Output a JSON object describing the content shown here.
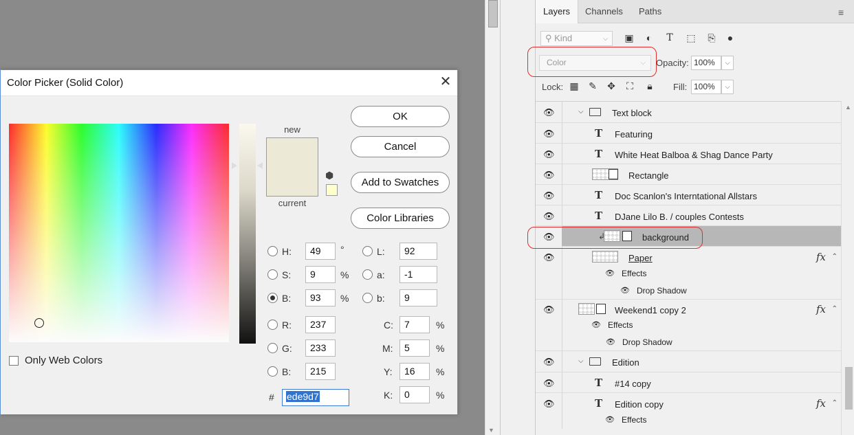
{
  "dialog": {
    "title": "Color Picker (Solid Color)",
    "close_label": "✕",
    "new_label": "new",
    "current_label": "current",
    "buttons": {
      "ok": "OK",
      "cancel": "Cancel",
      "add_swatches": "Add to Swatches",
      "libraries": "Color Libraries"
    },
    "fields": {
      "H": {
        "label": "H:",
        "value": "49",
        "unit": "°"
      },
      "S": {
        "label": "S:",
        "value": "9",
        "unit": "%"
      },
      "B": {
        "label": "B:",
        "value": "93",
        "unit": "%"
      },
      "R": {
        "label": "R:",
        "value": "237"
      },
      "G": {
        "label": "G:",
        "value": "233"
      },
      "Bl": {
        "label": "B:",
        "value": "215"
      },
      "L": {
        "label": "L:",
        "value": "92"
      },
      "a": {
        "label": "a:",
        "value": "-1"
      },
      "b": {
        "label": "b:",
        "value": "9"
      },
      "C": {
        "label": "C:",
        "value": "7",
        "unit": "%"
      },
      "M": {
        "label": "M:",
        "value": "5",
        "unit": "%"
      },
      "Y": {
        "label": "Y:",
        "value": "16",
        "unit": "%"
      },
      "K": {
        "label": "K:",
        "value": "0",
        "unit": "%"
      }
    },
    "hash_label": "#",
    "hex": "ede9d7",
    "web_colors_label": "Only Web Colors",
    "selected_radio": "B",
    "new_color": "#ede9d7",
    "current_color": "#ede9d7"
  },
  "panel": {
    "tabs": [
      "Layers",
      "Channels",
      "Paths"
    ],
    "active_tab": "Layers",
    "kind_placeholder": "Kind",
    "blend_mode": "Color",
    "opacity_label": "Opacity:",
    "opacity_value": "100%",
    "lock_label": "Lock:",
    "fill_label": "Fill:",
    "fill_value": "100%",
    "layers": [
      {
        "name": "Text block",
        "type": "group"
      },
      {
        "name": "Featuring",
        "type": "text"
      },
      {
        "name": "White Heat Balboa & Shag Dance Party",
        "type": "text"
      },
      {
        "name": "Rectangle",
        "type": "shape"
      },
      {
        "name": "Doc Scanlon's  Interntational  Allstars",
        "type": "text"
      },
      {
        "name": "DJane Lilo B. / couples Contests",
        "type": "text"
      },
      {
        "name": "background",
        "type": "clipped-shape",
        "selected": true
      },
      {
        "name": "Paper",
        "type": "image",
        "fx": "fx"
      },
      {
        "name": "Effects",
        "type": "effects"
      },
      {
        "name": "Drop Shadow",
        "type": "effect"
      },
      {
        "name": "Weekend1 copy 2",
        "type": "smart",
        "fx": "fx"
      },
      {
        "name": "Effects",
        "type": "effects"
      },
      {
        "name": "Drop Shadow",
        "type": "effect"
      },
      {
        "name": "Edition",
        "type": "group"
      },
      {
        "name": "#14 copy",
        "type": "text"
      },
      {
        "name": "Edition copy",
        "type": "text",
        "fx": "fx"
      },
      {
        "name": "Effects",
        "type": "effects"
      }
    ]
  },
  "colors": {
    "highlight_ring": "#e02d2d",
    "selection": "#3074d0"
  }
}
